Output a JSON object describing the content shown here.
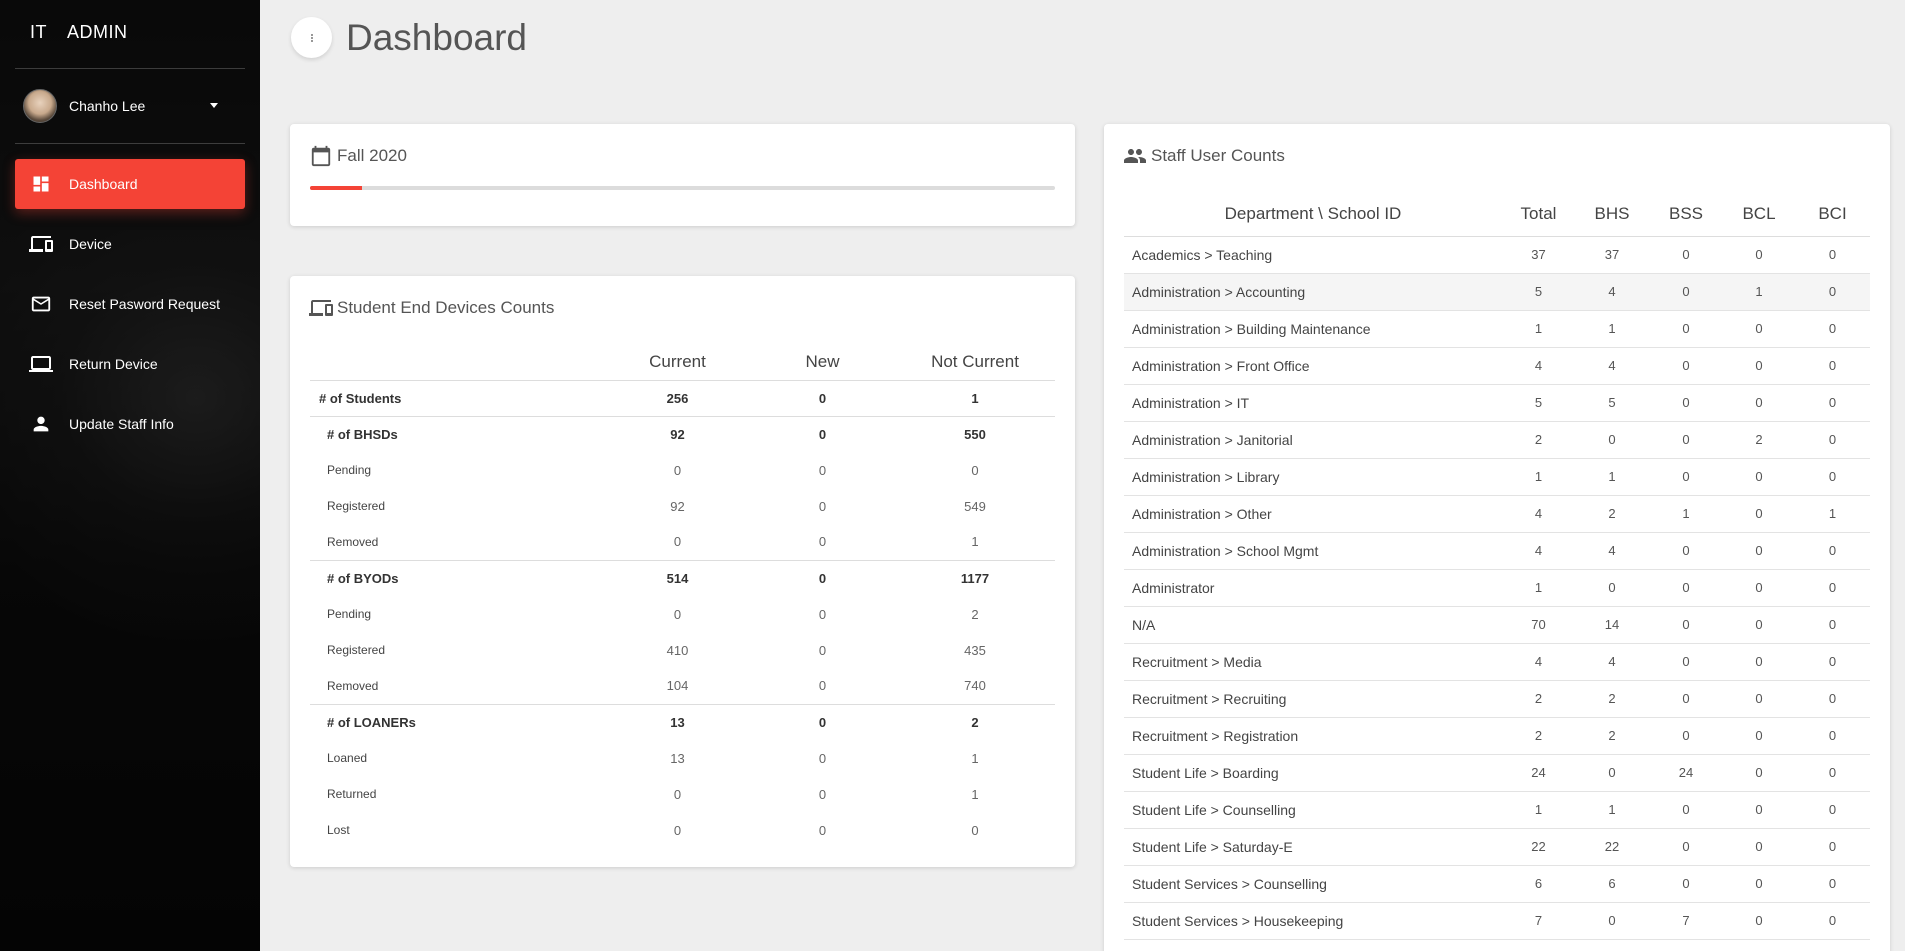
{
  "brand": {
    "part1": "IT",
    "part2": "ADMIN"
  },
  "user": {
    "name": "Chanho Lee"
  },
  "sidebar": {
    "items": [
      {
        "label": "Dashboard",
        "icon": "dashboard-icon",
        "active": true
      },
      {
        "label": "Device",
        "icon": "devices-icon",
        "active": false
      },
      {
        "label": "Reset Pasword Request",
        "icon": "mail-icon",
        "active": false
      },
      {
        "label": "Return Device",
        "icon": "laptop-icon",
        "active": false
      },
      {
        "label": "Update Staff Info",
        "icon": "person-icon",
        "active": false
      }
    ]
  },
  "header": {
    "title": "Dashboard"
  },
  "term": {
    "label": "Fall 2020",
    "progress": 0.07,
    "accent": "#f44336"
  },
  "devices": {
    "title": "Student End Devices Counts",
    "columns": [
      "",
      "Current",
      "New",
      "Not Current"
    ],
    "rows": [
      {
        "label": "# of Students",
        "level": 0,
        "current": "256",
        "new": "0",
        "not_current": "1"
      },
      {
        "label": "# of BHSDs",
        "level": 1,
        "current": "92",
        "new": "0",
        "not_current": "550"
      },
      {
        "label": "Pending",
        "level": 2,
        "current": "0",
        "new": "0",
        "not_current": "0"
      },
      {
        "label": "Registered",
        "level": 2,
        "current": "92",
        "new": "0",
        "not_current": "549"
      },
      {
        "label": "Removed",
        "level": 2,
        "current": "0",
        "new": "0",
        "not_current": "1",
        "group_end": true
      },
      {
        "label": "# of BYODs",
        "level": 1,
        "current": "514",
        "new": "0",
        "not_current": "1177"
      },
      {
        "label": "Pending",
        "level": 2,
        "current": "0",
        "new": "0",
        "not_current": "2"
      },
      {
        "label": "Registered",
        "level": 2,
        "current": "410",
        "new": "0",
        "not_current": "435"
      },
      {
        "label": "Removed",
        "level": 2,
        "current": "104",
        "new": "0",
        "not_current": "740",
        "group_end": true
      },
      {
        "label": "# of LOANERs",
        "level": 1,
        "current": "13",
        "new": "0",
        "not_current": "2"
      },
      {
        "label": "Loaned",
        "level": 2,
        "current": "13",
        "new": "0",
        "not_current": "1"
      },
      {
        "label": "Returned",
        "level": 2,
        "current": "0",
        "new": "0",
        "not_current": "1"
      },
      {
        "label": "Lost",
        "level": 2,
        "current": "0",
        "new": "0",
        "not_current": "0"
      }
    ]
  },
  "staff": {
    "title": "Staff User Counts",
    "columns": [
      "Department \\ School ID",
      "Total",
      "BHS",
      "BSS",
      "BCL",
      "BCI"
    ],
    "rows": [
      [
        "Academics > Teaching",
        "37",
        "37",
        "0",
        "0",
        "0"
      ],
      [
        "Administration > Accounting",
        "5",
        "4",
        "0",
        "1",
        "0"
      ],
      [
        "Administration > Building Maintenance",
        "1",
        "1",
        "0",
        "0",
        "0"
      ],
      [
        "Administration > Front Office",
        "4",
        "4",
        "0",
        "0",
        "0"
      ],
      [
        "Administration > IT",
        "5",
        "5",
        "0",
        "0",
        "0"
      ],
      [
        "Administration > Janitorial",
        "2",
        "0",
        "0",
        "2",
        "0"
      ],
      [
        "Administration > Library",
        "1",
        "1",
        "0",
        "0",
        "0"
      ],
      [
        "Administration > Other",
        "4",
        "2",
        "1",
        "0",
        "1"
      ],
      [
        "Administration > School Mgmt",
        "4",
        "4",
        "0",
        "0",
        "0"
      ],
      [
        "Administrator",
        "1",
        "0",
        "0",
        "0",
        "0"
      ],
      [
        "N/A",
        "70",
        "14",
        "0",
        "0",
        "0"
      ],
      [
        "Recruitment > Media",
        "4",
        "4",
        "0",
        "0",
        "0"
      ],
      [
        "Recruitment > Recruiting",
        "2",
        "2",
        "0",
        "0",
        "0"
      ],
      [
        "Recruitment > Registration",
        "2",
        "2",
        "0",
        "0",
        "0"
      ],
      [
        "Student Life > Boarding",
        "24",
        "0",
        "24",
        "0",
        "0"
      ],
      [
        "Student Life > Counselling",
        "1",
        "1",
        "0",
        "0",
        "0"
      ],
      [
        "Student Life > Saturday-E",
        "22",
        "22",
        "0",
        "0",
        "0"
      ],
      [
        "Student Services > Counselling",
        "6",
        "6",
        "0",
        "0",
        "0"
      ],
      [
        "Student Services > Housekeeping",
        "7",
        "0",
        "7",
        "0",
        "0"
      ]
    ],
    "highlighted_row": 1
  }
}
